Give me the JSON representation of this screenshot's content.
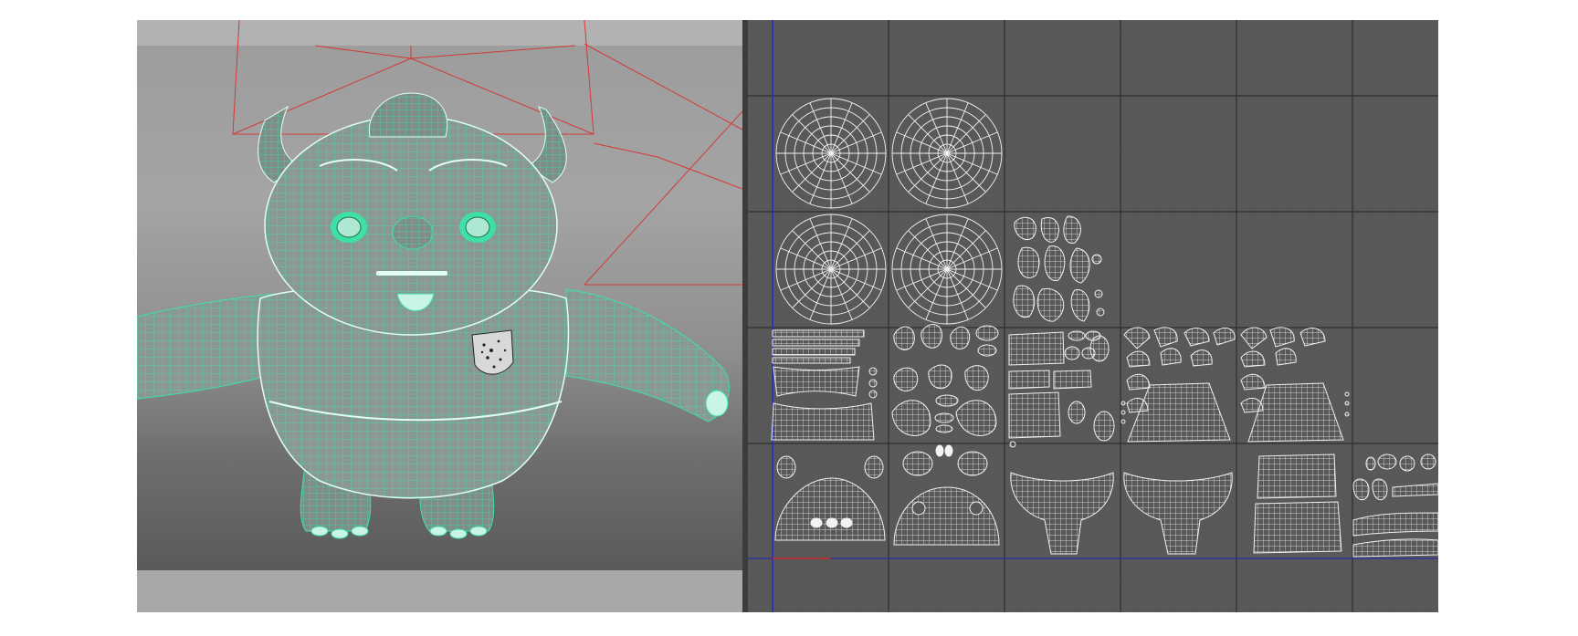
{
  "app": {
    "viewport_name": "perspective-viewport",
    "uv_editor_name": "uv-texture-editor"
  },
  "colors": {
    "wireframe": "#3fe0a6",
    "mesh_fill": "#8e9b97",
    "camera_lines": "#d23a3a",
    "uv_grid_bg": "#585858",
    "uv_gridlines": "#2e2e2e",
    "uv_shells": "#f2f2f2",
    "v_axis": "#2a2ad0",
    "u_axis": "#d02a2a"
  },
  "icons": [
    "character-model",
    "camera-frustum",
    "uv-shell",
    "uv-axis"
  ],
  "uv_tiles": {
    "columns": 6,
    "rows": 5,
    "shell_groups": [
      "eye-sphere-top-left",
      "eye-sphere-top-right",
      "eye-sphere-mid-left",
      "eye-sphere-mid-right",
      "hair-strand-shells",
      "strip-shells",
      "claw-shells",
      "body-pieces",
      "arm-shells-a",
      "arm-shells-b",
      "head-shell",
      "face-shell",
      "torso-front",
      "torso-back",
      "leg-shells",
      "misc-shells"
    ]
  }
}
